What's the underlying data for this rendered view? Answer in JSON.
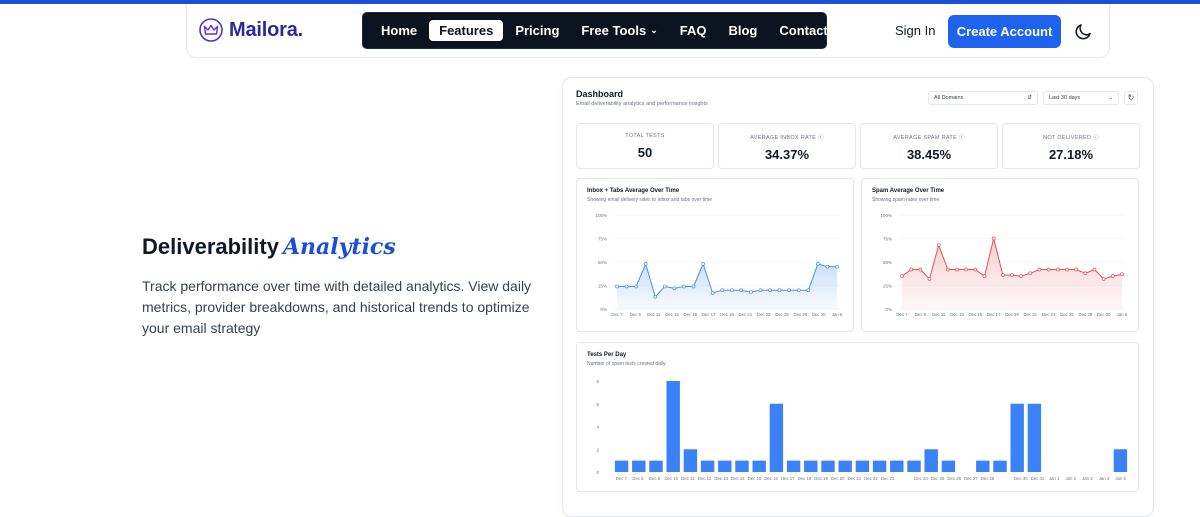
{
  "brand": {
    "name": "Mailora",
    "dot": ".",
    "accent": "#2e2a9e",
    "primary": "#1d63ed"
  },
  "nav": {
    "items": [
      {
        "label": "Home",
        "active": false
      },
      {
        "label": "Features",
        "active": true
      },
      {
        "label": "Pricing",
        "active": false
      },
      {
        "label": "Free Tools",
        "active": false,
        "dropdown": true
      },
      {
        "label": "FAQ",
        "active": false
      },
      {
        "label": "Blog",
        "active": false
      },
      {
        "label": "Contact",
        "active": false
      }
    ],
    "sign_in": "Sign In",
    "create_account": "Create Account",
    "theme_icon": "moon-icon"
  },
  "hero": {
    "title": "Deliverability",
    "title_accent": "Analytics",
    "description": "Track performance over time with detailed analytics. View daily metrics, provider breakdowns, and historical trends to optimize your email strategy"
  },
  "dashboard": {
    "title": "Dashboard",
    "subtitle": "Email deliverability analytics and performance insights",
    "domain_select": "All Domains",
    "range_select": "Last 30 days",
    "stats": [
      {
        "label": "TOTAL TESTS",
        "value": "50",
        "info": false
      },
      {
        "label": "AVERAGE INBOX RATE",
        "value": "34.37%",
        "info": true
      },
      {
        "label": "AVERAGE SPAM RATE",
        "value": "38.45%",
        "info": true
      },
      {
        "label": "NOT DELIVERED",
        "value": "27.18%",
        "info": true
      }
    ]
  },
  "chart_data": [
    {
      "type": "area",
      "title": "Inbox + Tabs Average Over Time",
      "subtitle": "Showing email delivery rates to inbox and tabs over time",
      "color": "#4a90e2",
      "yticks": [
        "100%",
        "75%",
        "50%",
        "25%",
        "0%"
      ],
      "ylim": [
        0,
        100
      ],
      "xticks": [
        "Dec 7",
        "Dec 9",
        "Dec 11",
        "Dec 13",
        "Dec 15",
        "Dec 17",
        "Dec 19",
        "Dec 21",
        "Dec 23",
        "Dec 25",
        "Dec 28",
        "Dec 30",
        "Jan 5"
      ],
      "values": [
        24,
        24,
        24,
        48,
        13,
        24,
        22,
        24,
        24,
        48,
        17,
        20,
        20,
        20,
        18,
        20,
        20,
        20,
        20,
        20,
        20,
        48,
        45,
        45
      ]
    },
    {
      "type": "area",
      "title": "Spam Average Over Time",
      "subtitle": "Showing spam rates over time",
      "color": "#e05252",
      "yticks": [
        "100%",
        "75%",
        "50%",
        "25%",
        "0%"
      ],
      "ylim": [
        0,
        100
      ],
      "xticks": [
        "Dec 7",
        "Dec 9",
        "Dec 11",
        "Dec 13",
        "Dec 15",
        "Dec 17",
        "Dec 19",
        "Dec 21",
        "Dec 23",
        "Dec 25",
        "Dec 28",
        "Dec 30",
        "Jan 5"
      ],
      "values": [
        35,
        42,
        42,
        32,
        68,
        42,
        42,
        42,
        42,
        35,
        75,
        36,
        36,
        35,
        38,
        42,
        42,
        42,
        42,
        42,
        38,
        42,
        32,
        35,
        37
      ]
    },
    {
      "type": "bar",
      "title": "Tests Per Day",
      "subtitle": "Number of spam tests created daily",
      "color": "#3b82f6",
      "yticks": [
        "8",
        "6",
        "4",
        "2",
        "0"
      ],
      "ylim": [
        0,
        8
      ],
      "categories": [
        "Dec 7",
        "Dec 8",
        "Dec 9",
        "Dec 10",
        "Dec 11",
        "Dec 12",
        "Dec 13",
        "Dec 14",
        "Dec 15",
        "Dec 16",
        "Dec 17",
        "Dec 18",
        "Dec 19",
        "Dec 20",
        "Dec 21",
        "Dec 22",
        "Dec 23",
        "Dec 24",
        "Dec 25",
        "Dec 26",
        "Dec 27",
        "Dec 28",
        "Dec 29",
        "Dec 30",
        "Dec 31",
        "Jan 1",
        "Jan 2",
        "Jan 3",
        "Jan 4",
        "Jan 5"
      ],
      "xlabels": [
        "Dec 7",
        "Dec 8",
        "Dec 9",
        "Dec 10",
        "Dec 11",
        "Dec 12",
        "Dec 13",
        "Dec 14",
        "Dec 15",
        "Dec 16",
        "Dec 17",
        "Dec 18",
        "Dec 19",
        "Dec 20",
        "Dec 21",
        "Dec 22",
        "Dec 23",
        "",
        "Dec 24",
        "Dec 25",
        "Dec 26",
        "Dec 27",
        "Dec 28",
        "",
        "Dec 30",
        "Dec 31",
        "Jan 1",
        "Jan 2",
        "Jan 3",
        "Jan 4",
        "Jan 5"
      ],
      "values": [
        1,
        1,
        1,
        8,
        2,
        1,
        1,
        1,
        1,
        6,
        1,
        1,
        1,
        1,
        1,
        1,
        1,
        1,
        2,
        1,
        0,
        1,
        1,
        6,
        6,
        0,
        0,
        0,
        0,
        2
      ]
    }
  ]
}
